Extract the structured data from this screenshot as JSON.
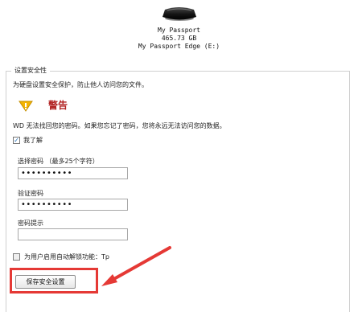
{
  "device": {
    "name": "My Passport",
    "capacity": "465.73 GB",
    "volume": "My Passport Edge (E:)",
    "icon": "external-drive-icon"
  },
  "panel": {
    "title": "设置安全性",
    "intro": "为硬盘设置安全保护，防止他人访问您的文件。",
    "warning_title": "警告",
    "warning_text": "WD 无法找回您的密码。如果您忘记了密码，您将永远无法访问您的数据。",
    "understand_label": "我了解",
    "understand_checked": true,
    "password_label": "选择密码 （最多25个字符）",
    "password_value": "••••••••••",
    "confirm_label": "验证密码",
    "confirm_value": "••••••••••",
    "hint_label": "密码提示",
    "hint_value": "",
    "auto_unlock_label": "为用户启用自动解锁功能：Tp",
    "auto_unlock_checked": false,
    "save_button": "保存安全设置"
  },
  "colors": {
    "warning_text": "#b22222",
    "annotation": "#e53935",
    "warning_icon": "#f4b400"
  }
}
